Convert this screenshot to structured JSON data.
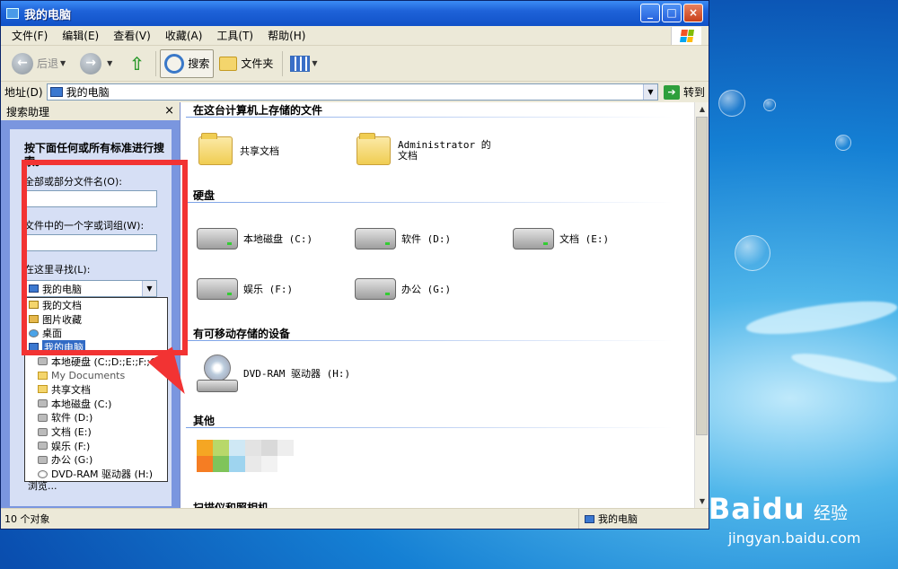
{
  "window": {
    "title": "我的电脑",
    "buttons": {
      "minimize": "_",
      "maximize": "□",
      "close": "×"
    }
  },
  "menu": [
    "文件(F)",
    "编辑(E)",
    "查看(V)",
    "收藏(A)",
    "工具(T)",
    "帮助(H)"
  ],
  "toolbar": {
    "back": "后退",
    "search": "搜索",
    "folders": "文件夹"
  },
  "address": {
    "label": "地址(D)",
    "value": "我的电脑",
    "go": "转到"
  },
  "search_pane": {
    "title": "搜索助理",
    "close": "×",
    "heading": "按下面任何或所有标准进行搜索。",
    "filename_label": "全部或部分文件名(O):",
    "phrase_label": "文件中的一个字或词组(W):",
    "look_in_label": "在这里寻找(L):",
    "look_in_value": "我的电脑",
    "dropdown_items": [
      {
        "label": "我的文档",
        "icon": "docs",
        "indent": false,
        "selected": false,
        "gray": false
      },
      {
        "label": "图片收藏",
        "icon": "pics",
        "indent": false,
        "selected": false,
        "gray": false
      },
      {
        "label": "桌面",
        "icon": "desk",
        "indent": false,
        "selected": false,
        "gray": false
      },
      {
        "label": "我的电脑",
        "icon": "pc",
        "indent": false,
        "selected": true,
        "gray": false
      },
      {
        "label": "本地硬盘 (C:;D:;E:;F:;G:)",
        "icon": "drive",
        "indent": true,
        "selected": false,
        "gray": false
      },
      {
        "label": "My Documents",
        "icon": "folder",
        "indent": true,
        "selected": false,
        "gray": true
      },
      {
        "label": "共享文档",
        "icon": "folder",
        "indent": true,
        "selected": false,
        "gray": false
      },
      {
        "label": "本地磁盘 (C:)",
        "icon": "drive",
        "indent": true,
        "selected": false,
        "gray": false
      },
      {
        "label": "软件 (D:)",
        "icon": "drive",
        "indent": true,
        "selected": false,
        "gray": false
      },
      {
        "label": "文档 (E:)",
        "icon": "drive",
        "indent": true,
        "selected": false,
        "gray": false
      },
      {
        "label": "娱乐 (F:)",
        "icon": "drive",
        "indent": true,
        "selected": false,
        "gray": false
      },
      {
        "label": "办公 (G:)",
        "icon": "drive",
        "indent": true,
        "selected": false,
        "gray": false
      },
      {
        "label": "DVD-RAM 驱动器 (H:)",
        "icon": "dvd",
        "indent": true,
        "selected": false,
        "gray": false
      }
    ],
    "browse": "浏览..."
  },
  "main": {
    "groups": {
      "stored": "在这台计算机上存储的文件",
      "drives": "硬盘",
      "removable": "有可移动存储的设备",
      "other": "其他",
      "scanners": "扫描仪和照相机"
    },
    "stored_items": [
      "共享文档",
      "Administrator 的文档"
    ],
    "drive_items": [
      "本地磁盘 (C:)",
      "软件 (D:)",
      "文档 (E:)",
      "娱乐 (F:)",
      "办公 (G:)"
    ],
    "removable_items": [
      "DVD-RAM 驱动器 (H:)"
    ]
  },
  "status": {
    "count": "10 个对象",
    "location": "我的电脑"
  },
  "desktop": {
    "watermark_logo": "Baidu",
    "watermark_sub": "经验",
    "watermark_url": "jingyan.baidu.com"
  },
  "colors": {
    "highlight": "#f23333",
    "titlebar": "#1e62d8",
    "pane": "#7a96df"
  }
}
